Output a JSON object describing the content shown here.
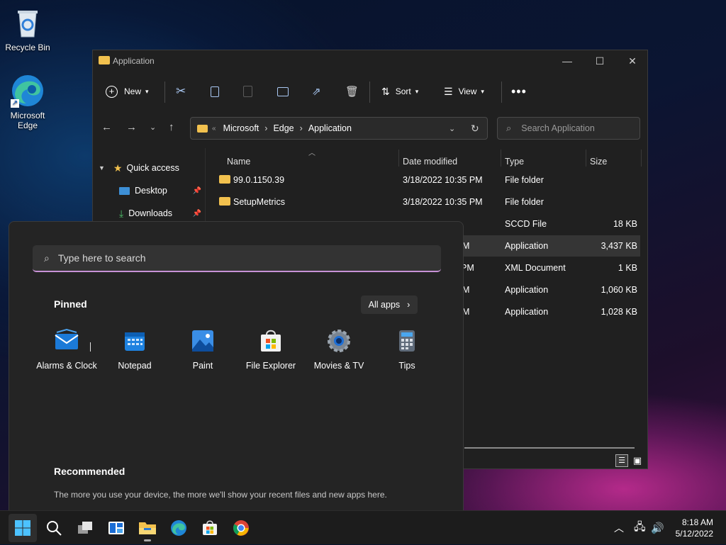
{
  "desktop": {
    "recycle_bin": "Recycle Bin",
    "edge_line1": "Microsoft",
    "edge_line2": "Edge"
  },
  "explorer": {
    "title": "Application",
    "toolbar": {
      "new": "New",
      "sort": "Sort",
      "view": "View"
    },
    "breadcrumb": {
      "overflow": "«",
      "part1": "Microsoft",
      "part2": "Edge",
      "part3": "Application"
    },
    "search_placeholder": "Search Application",
    "nav": {
      "quick_access": "Quick access",
      "desktop": "Desktop",
      "downloads": "Downloads"
    },
    "columns": {
      "name": "Name",
      "date": "Date modified",
      "type": "Type",
      "size": "Size"
    },
    "rows": [
      {
        "name": "99.0.1150.39",
        "date": "3/18/2022 10:35 PM",
        "type": "File folder",
        "size": ""
      },
      {
        "name": "SetupMetrics",
        "date": "3/18/2022 10:35 PM",
        "type": "File folder",
        "size": ""
      },
      {
        "name": "",
        "date": "",
        "type": "SCCD File",
        "size": "18 KB"
      },
      {
        "name": "",
        "date": "M",
        "type": "Application",
        "size": "3,437 KB"
      },
      {
        "name": "",
        "date": "PM",
        "type": "XML Document",
        "size": "1 KB"
      },
      {
        "name": "",
        "date": "M",
        "type": "Application",
        "size": "1,060 KB"
      },
      {
        "name": "",
        "date": "M",
        "type": "Application",
        "size": "1,028 KB"
      }
    ]
  },
  "start": {
    "search_placeholder": "Type here to search",
    "pinned": "Pinned",
    "all_apps": "All apps",
    "apps": [
      "Alarms & Clock",
      "Notepad",
      "Paint",
      "File Explorer",
      "Movies & TV",
      "Tips"
    ],
    "recommended": "Recommended",
    "recommended_text": "The more you use your device, the more we'll show your recent files and new apps here."
  },
  "taskbar": {
    "time": "8:18 AM",
    "date": "5/12/2022"
  },
  "colors": {
    "accent": "#c792d6",
    "folder": "#f2c14e",
    "explorer_bg": "#202020",
    "start_bg": "#242424"
  }
}
